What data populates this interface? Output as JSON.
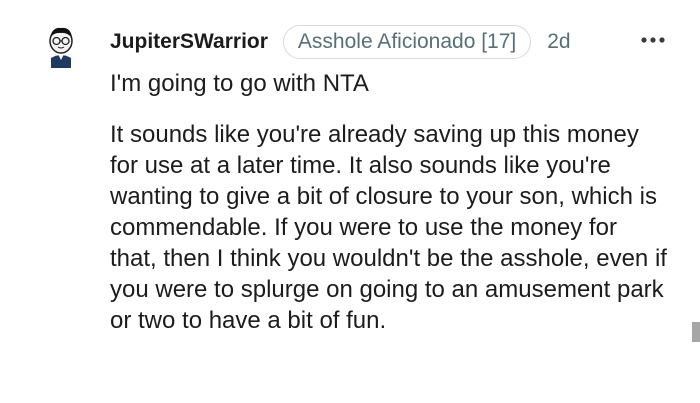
{
  "comment": {
    "username": "JupiterSWarrior",
    "flair": "Asshole Aficionado [17]",
    "time": "2d",
    "more_icon": "more-horizontal-icon",
    "avatar_icon": "snoo-avatar-icon",
    "paragraphs": [
      "I'm going to go with NTA",
      "It sounds like you're already saving up this money for use at a later time. It also sounds like you're wanting to give a bit of closure to your son, which is commendable. If you were to use the money for that, then I think you wouldn't be the asshole, even if you were to splurge on going to an amusement park or two to have a bit of fun."
    ]
  }
}
